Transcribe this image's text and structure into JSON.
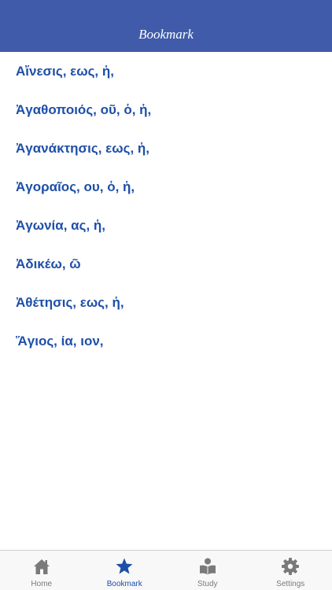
{
  "header": {
    "title": "Bookmark"
  },
  "bookmarks": [
    "Αἴνεσις, εως, ἡ,",
    "Ἀγαθοποιός, οῦ, ὁ, ἡ,",
    "Ἀγανάκτησις, εως, ἡ,",
    "Ἀγοραῖος, ου, ὁ, ἡ,",
    "Ἀγωνία, ας, ἡ,",
    "Ἀδικέω, ῶ",
    "Ἀθέτησις, εως, ἡ,",
    "Ἅγιος, ία, ιον,"
  ],
  "tabs": [
    {
      "label": "Home",
      "icon": "house-icon"
    },
    {
      "label": "Bookmark",
      "icon": "star-icon",
      "active": true
    },
    {
      "label": "Study",
      "icon": "reader-icon"
    },
    {
      "label": "Settings",
      "icon": "gear-icon"
    }
  ],
  "colors": {
    "nav_background": "#3f5ba9",
    "accent": "#1e4fa8",
    "inactive_tab": "#7a7a7a"
  }
}
